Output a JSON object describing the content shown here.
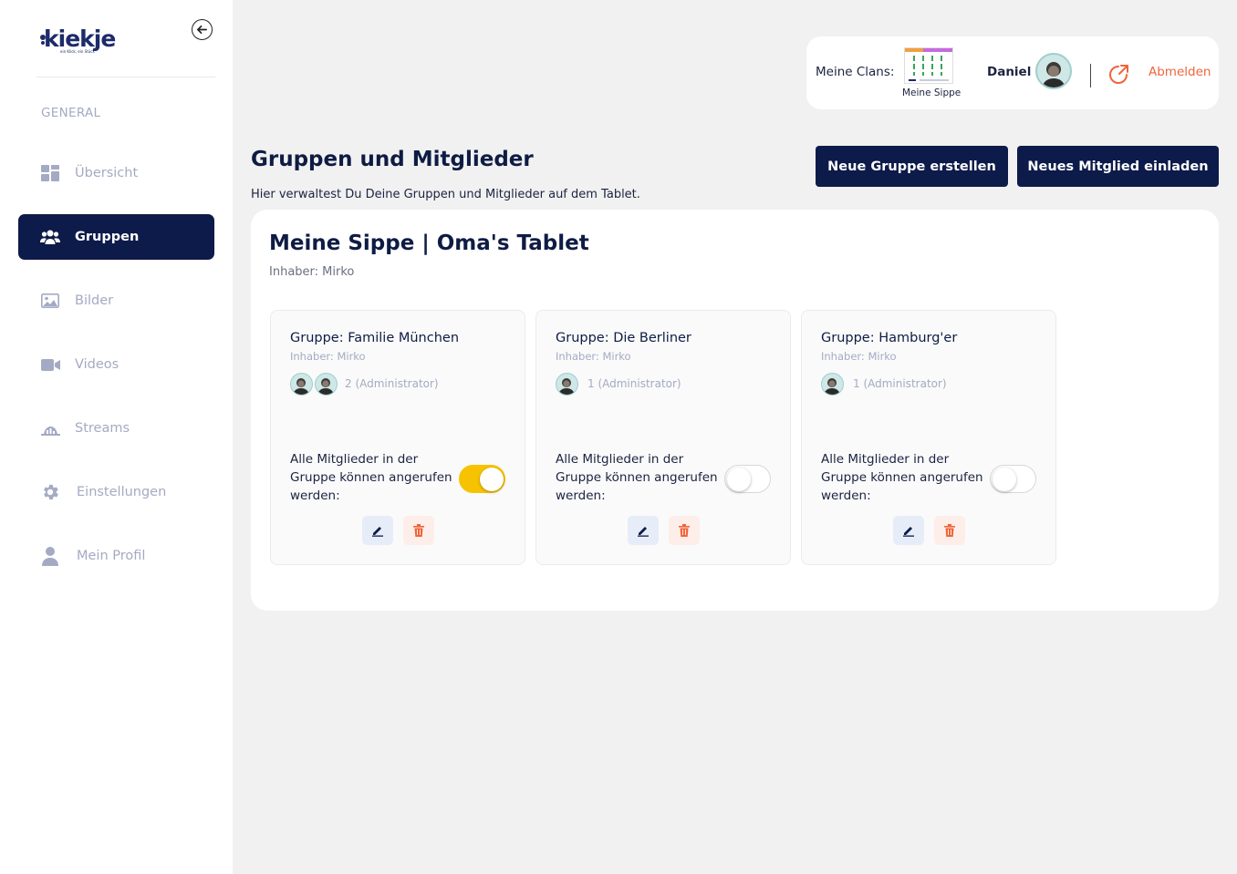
{
  "brand": {
    "name": "kiekje",
    "tagline": "ein Klick, ein Stück"
  },
  "sidebar": {
    "section_label": "GENERAL",
    "items": [
      {
        "label": "Übersicht",
        "icon": "dashboard-icon",
        "active": false
      },
      {
        "label": "Gruppen",
        "icon": "users-icon",
        "active": true
      },
      {
        "label": "Bilder",
        "icon": "image-icon",
        "active": false
      },
      {
        "label": "Videos",
        "icon": "video-icon",
        "active": false
      },
      {
        "label": "Streams",
        "icon": "streams-icon",
        "active": false
      },
      {
        "label": "Einstellungen",
        "icon": "gear-icon",
        "active": false
      },
      {
        "label": "Mein Profil",
        "icon": "user-icon",
        "active": false
      }
    ]
  },
  "header": {
    "clans_label": "Meine Clans:",
    "clan_name": "Meine Sippe",
    "user_name": "Daniel",
    "logout_label": "Abmelden"
  },
  "page": {
    "title": "Gruppen und Mitglieder",
    "subtitle": "Hier verwaltest Du Deine Gruppen und Mitglieder auf dem Tablet.",
    "new_group_button": "Neue Gruppe erstellen",
    "invite_button": "Neues Mitglied einladen"
  },
  "panel": {
    "title": "Meine Sippe | Oma's Tablet",
    "owner": "Inhaber: Mirko"
  },
  "groups": [
    {
      "title": "Gruppe: Familie München",
      "owner": "Inhaber: Mirko",
      "members": "2 (Administrator)",
      "avatar_count": 2,
      "call_text": "Alle Mitglieder in der Gruppe können angerufen werden:",
      "call_enabled": true
    },
    {
      "title": "Gruppe: Die Berliner",
      "owner": "Inhaber: Mirko",
      "members": "1 (Administrator)",
      "avatar_count": 1,
      "call_text": "Alle Mitglieder in der Gruppe können angerufen werden:",
      "call_enabled": false
    },
    {
      "title": "Gruppe: Hamburg'er",
      "owner": "Inhaber: Mirko",
      "members": "1 (Administrator)",
      "avatar_count": 1,
      "call_text": "Alle Mitglieder in der Gruppe können angerufen werden:",
      "call_enabled": false
    }
  ],
  "colors": {
    "navy": "#0d1b4a",
    "accent_orange": "#f0643a",
    "toggle_on": "#f7c300",
    "sidebar_muted": "#a4aac3",
    "background": "#f1f1f1"
  }
}
